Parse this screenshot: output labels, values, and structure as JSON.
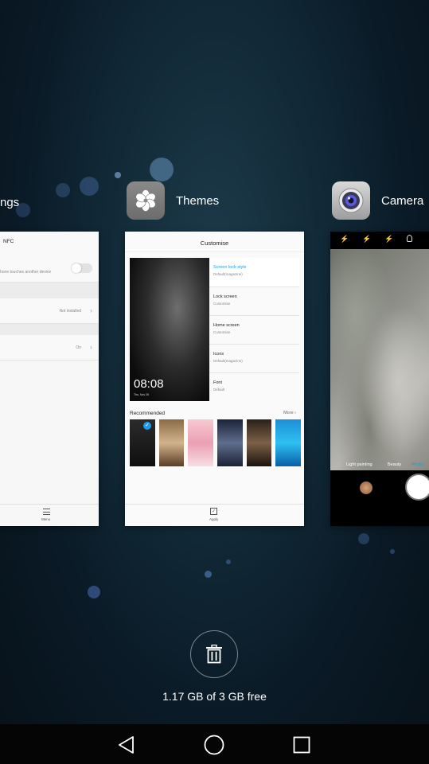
{
  "recents": {
    "settings_card": {
      "title": "ngs",
      "nfc_label": "NFC",
      "nfc_desc": "hone touches another device",
      "row2_value": "Not installed",
      "row3_value": "On",
      "menu_label": "Menu"
    },
    "themes_card": {
      "title": "Themes",
      "header": "Customise",
      "preview_time": "08:08",
      "preview_date": "Thu, Nov 26",
      "options": [
        {
          "title": "Screen lock style",
          "sub": "Default(magazine)"
        },
        {
          "title": "Lock screen",
          "sub": "Customise"
        },
        {
          "title": "Home screen",
          "sub": "Customise"
        },
        {
          "title": "Icons",
          "sub": "Default(magazine)"
        },
        {
          "title": "Font",
          "sub": "Default"
        }
      ],
      "recommended_label": "Recommended",
      "more_label": "More",
      "apply_label": "Apply"
    },
    "camera_card": {
      "title": "Camera",
      "modes": [
        "Light painting",
        "Beauty",
        "Photo"
      ]
    }
  },
  "memory_text": "1.17 GB of 3 GB free",
  "colors": {
    "accent_blue": "#1e9be8",
    "background": "#0e2330"
  },
  "icons": [
    "trash-icon",
    "back-icon",
    "home-icon",
    "recents-icon",
    "themes-icon",
    "camera-icon"
  ]
}
